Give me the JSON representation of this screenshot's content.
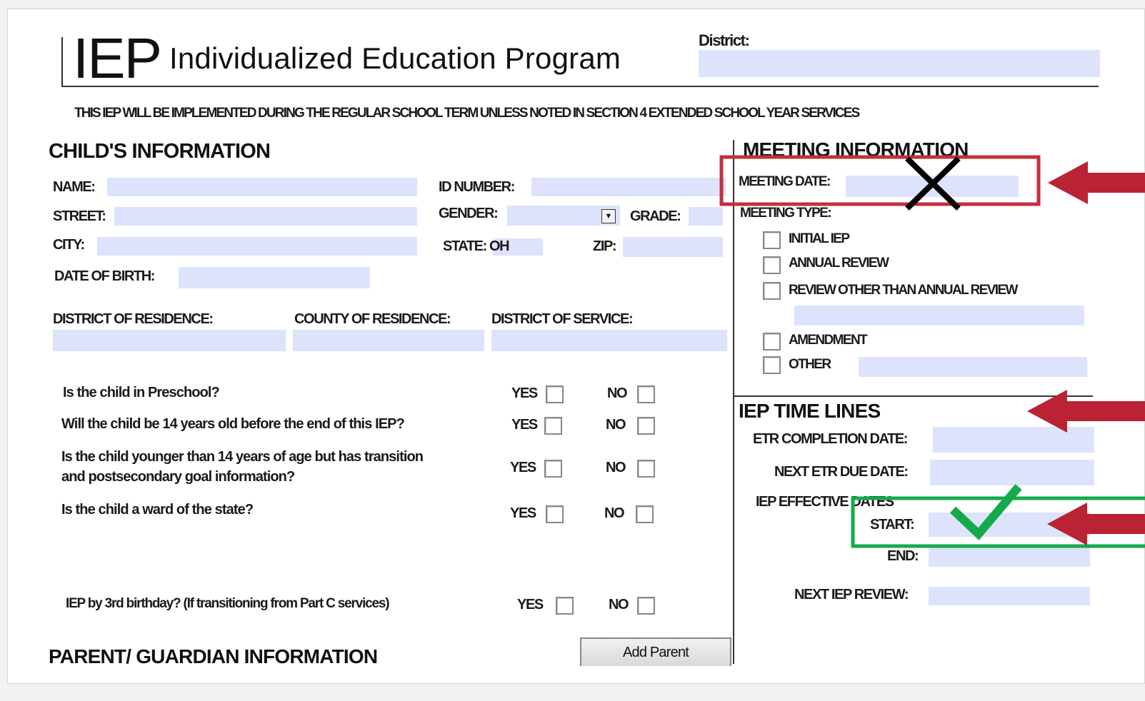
{
  "header": {
    "logo_abbr": "IEP",
    "logo_full": "Individualized Education Program",
    "district_label": "District:"
  },
  "notice": "THIS IEP WILL BE IMPLEMENTED DURING THE REGULAR SCHOOL TERM UNLESS NOTED IN SECTION 4 EXTENDED SCHOOL YEAR SERVICES",
  "child_info": {
    "title": "CHILD'S INFORMATION",
    "name": "NAME:",
    "id_number": "ID NUMBER:",
    "street": "STREET:",
    "gender": "GENDER:",
    "grade": "GRADE:",
    "city": "CITY:",
    "state": "STATE: OH",
    "zip": "ZIP:",
    "dob": "DATE OF BIRTH:",
    "district_residence": "DISTRICT OF RESIDENCE:",
    "county_residence": "COUNTY OF RESIDENCE:",
    "district_service": "DISTRICT OF SERVICE:"
  },
  "questions": [
    {
      "text": "Is the child in Preschool?",
      "yes": "YES",
      "no": "NO"
    },
    {
      "text": "Will the child be 14 years old before the end of this IEP?",
      "yes": "YES",
      "no": "NO"
    },
    {
      "text_line1": "Is the child younger than 14 years of age but has transition",
      "text_line2": "and postsecondary goal information?",
      "yes": "YES",
      "no": "NO"
    },
    {
      "text": "Is the child a ward of the state?",
      "yes": "YES",
      "no": "NO"
    },
    {
      "text": "IEP by 3rd birthday? (If transitioning from Part C services)",
      "yes": "YES",
      "no": "NO"
    }
  ],
  "parent_section": {
    "title": "PARENT/ GUARDIAN INFORMATION",
    "add_parent": "Add Parent"
  },
  "meeting": {
    "title": "MEETING INFORMATION",
    "date": "MEETING DATE:",
    "type": "MEETING TYPE:",
    "options": [
      "INITIAL IEP",
      "ANNUAL REVIEW",
      "REVIEW OTHER THAN ANNUAL REVIEW",
      "AMENDMENT",
      "OTHER"
    ]
  },
  "timelines": {
    "title": "IEP TIME LINES",
    "etr_completion": "ETR COMPLETION DATE:",
    "next_etr": "NEXT ETR DUE DATE:",
    "effective": "IEP EFFECTIVE DATES",
    "start": "START:",
    "end": "END:",
    "next_review": "NEXT IEP REVIEW:"
  },
  "colors": {
    "field": "#dde3fb",
    "highlight_red": "#c0313f",
    "highlight_green": "#14aa4c",
    "arrow": "#b92333"
  }
}
